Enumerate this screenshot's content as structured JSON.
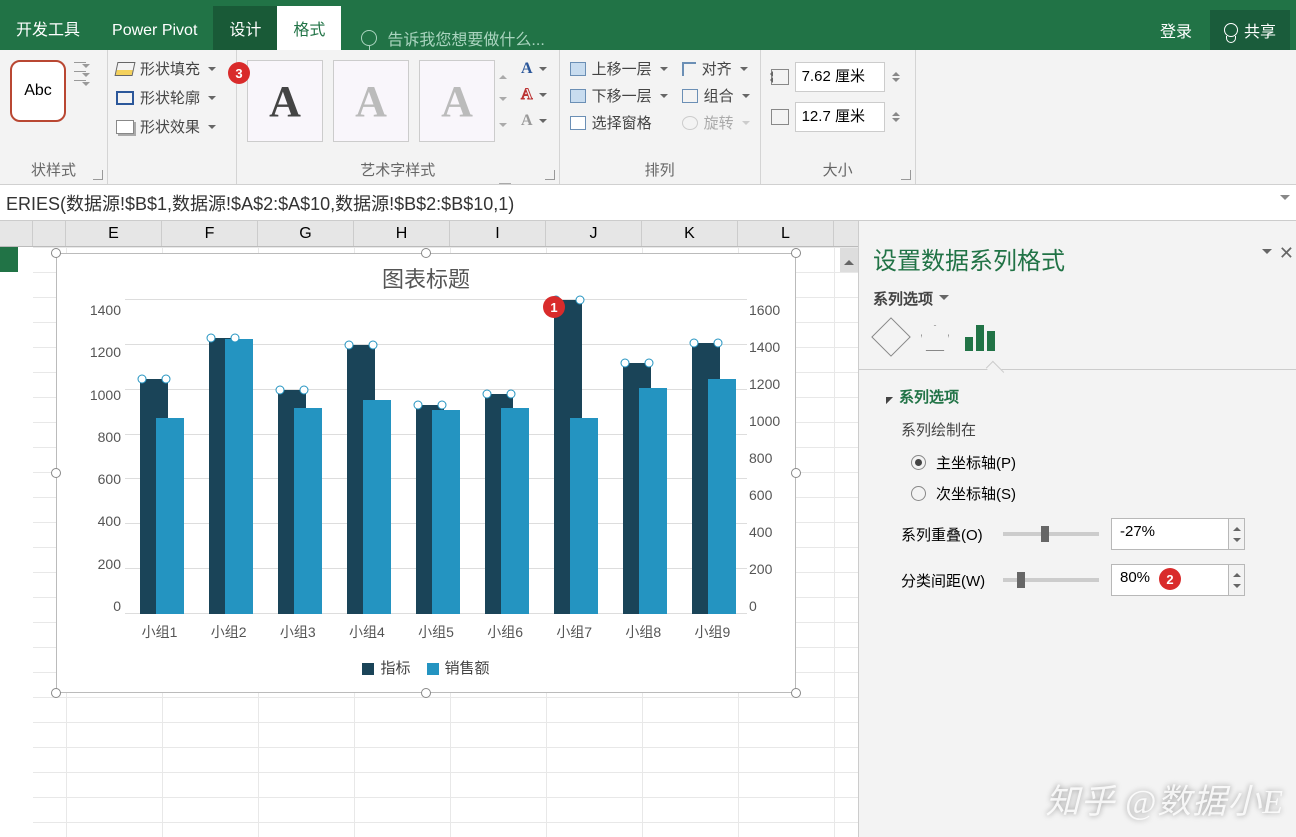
{
  "tabs": {
    "dev": "开发工具",
    "pivot": "Power Pivot",
    "design": "设计",
    "format": "格式"
  },
  "search_placeholder": "告诉我您想要做什么...",
  "top_right": {
    "login": "登录",
    "share": "共享"
  },
  "ribbon": {
    "shape_style_sample": "Abc",
    "shape_fill": "形状填充",
    "shape_outline": "形状轮廓",
    "shape_effects": "形状效果",
    "group_shape_styles": "状样式",
    "group_wordart": "艺术字样式",
    "group_arrange": "排列",
    "group_size": "大小",
    "bring_forward": "上移一层",
    "send_backward": "下移一层",
    "selection_pane": "选择窗格",
    "align": "对齐",
    "group": "组合",
    "rotate": "旋转",
    "height_val": "7.62 厘米",
    "width_val": "12.7 厘米"
  },
  "formula": "ERIES(数据源!$B$1,数据源!$A$2:$A$10,数据源!$B$2:$B$10,1)",
  "columns": [
    "E",
    "F",
    "G",
    "H",
    "I",
    "J",
    "K",
    "L"
  ],
  "pane": {
    "title": "设置数据系列格式",
    "subtitle": "系列选项",
    "section": "系列选项",
    "plot_on": "系列绘制在",
    "primary": "主坐标轴(P)",
    "secondary": "次坐标轴(S)",
    "overlap": "系列重叠(O)",
    "overlap_val": "-27%",
    "gap": "分类间距(W)",
    "gap_val": "80%"
  },
  "chart_data": {
    "type": "bar",
    "title": "图表标题",
    "categories": [
      "小组1",
      "小组2",
      "小组3",
      "小组4",
      "小组5",
      "小组6",
      "小组7",
      "小组8",
      "小组9"
    ],
    "series": [
      {
        "name": "指标",
        "axis": "primary",
        "color": "#1a4458",
        "values": [
          1050,
          1230,
          1000,
          1200,
          930,
          980,
          1400,
          1120,
          1210
        ]
      },
      {
        "name": "销售额",
        "axis": "secondary",
        "color": "#2494c1",
        "values": [
          1000,
          1400,
          1050,
          1090,
          1040,
          1050,
          1000,
          1150,
          1200
        ]
      }
    ],
    "y_primary": {
      "min": 0,
      "max": 1400,
      "step": 200,
      "ticks": [
        "1400",
        "1200",
        "1000",
        "800",
        "600",
        "400",
        "200",
        "0"
      ]
    },
    "y_secondary": {
      "min": 0,
      "max": 1600,
      "step": 200,
      "ticks": [
        "1600",
        "1400",
        "1200",
        "1000",
        "800",
        "600",
        "400",
        "200",
        "0"
      ]
    },
    "legend": [
      "指标",
      "销售额"
    ]
  },
  "badges": {
    "b1": "1",
    "b2": "2",
    "b3": "3"
  },
  "watermark": "知乎 @数据小E"
}
